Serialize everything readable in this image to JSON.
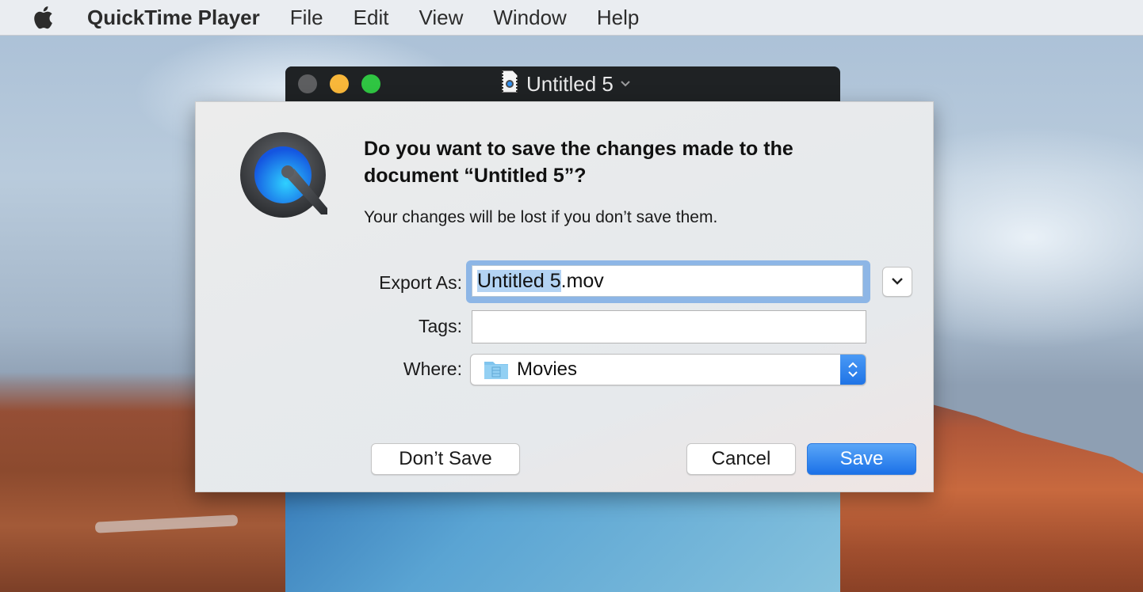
{
  "menubar": {
    "apple_icon": "apple-logo-icon",
    "app_name": "QuickTime Player",
    "items": [
      "File",
      "Edit",
      "View",
      "Window",
      "Help"
    ]
  },
  "window": {
    "title": "Untitled 5",
    "document_icon": "movie-document-icon",
    "title_menu_icon": "chevron-down-icon",
    "traffic_lights": {
      "close_color": "#5d5e60",
      "minimize_color": "#f8b73a",
      "zoom_color": "#2fc542"
    }
  },
  "dialog": {
    "app_icon": "quicktime-icon",
    "title": "Do you want to save the changes made to the document “Untitled 5”?",
    "info": "Your changes will be lost if you don’t save them.",
    "export_as": {
      "label": "Export As:",
      "selected_part": "Untitled 5",
      "rest": ".mov",
      "value": "Untitled 5.mov"
    },
    "tags": {
      "label": "Tags:",
      "value": ""
    },
    "where": {
      "label": "Where:",
      "value": "Movies",
      "icon": "movies-folder-icon"
    },
    "buttons": {
      "dont_save": "Don’t Save",
      "cancel": "Cancel",
      "save": "Save"
    },
    "colors": {
      "accent": "#1b71e8",
      "focus_ring": "#8db6e6",
      "selection": "#b3d3f3"
    }
  }
}
